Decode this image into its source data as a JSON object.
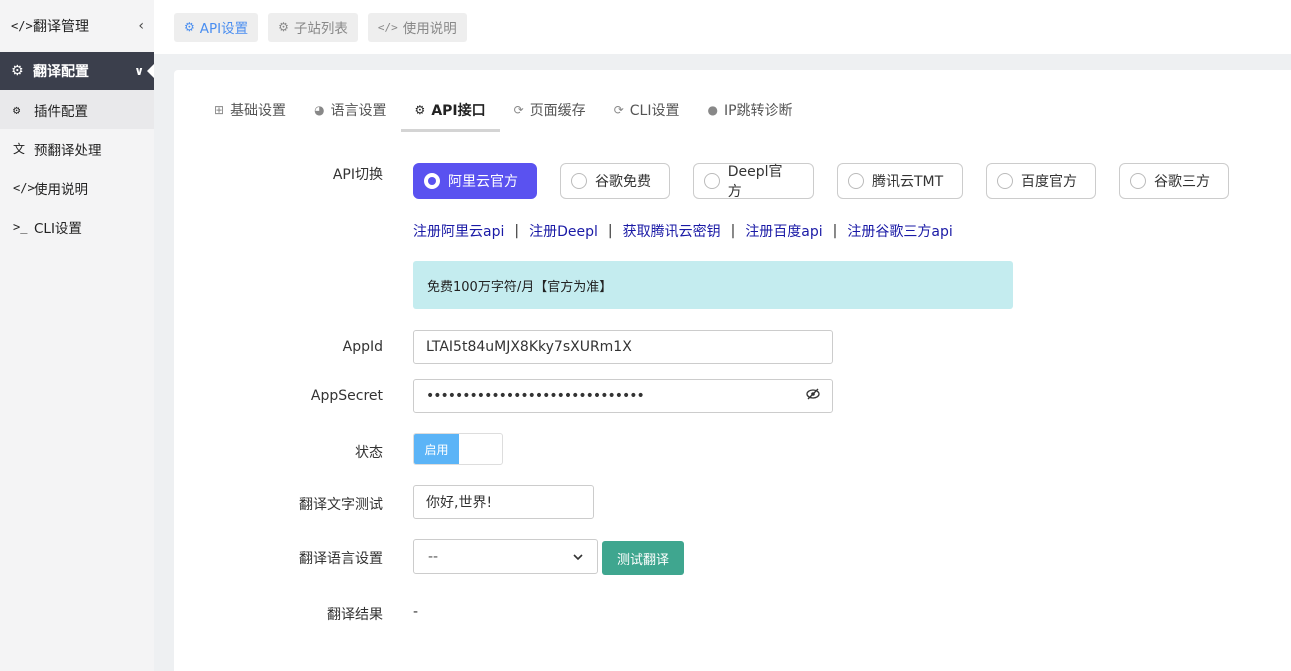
{
  "sidebar": {
    "header": {
      "icon": "code-icon",
      "label": "翻译管理",
      "collapse": "‹"
    },
    "section": {
      "icon": "gear-icon",
      "label": "翻译配置",
      "chevron": "⌄"
    },
    "items": [
      {
        "icon": "gear-icon",
        "label": "插件配置"
      },
      {
        "icon": "translate-icon",
        "label": "预翻译处理"
      },
      {
        "icon": "code-icon",
        "label": "使用说明"
      },
      {
        "icon": "terminal-icon",
        "label": "CLI设置"
      }
    ]
  },
  "topnav": {
    "buttons": [
      {
        "icon": "gear-icon",
        "label": "API设置"
      },
      {
        "icon": "gears-icon",
        "label": "子站列表"
      },
      {
        "icon": "code-icon",
        "label": "使用说明"
      }
    ]
  },
  "tabs": [
    {
      "icon": "sitemap-icon",
      "label": "基础设置"
    },
    {
      "icon": "dashboard-icon",
      "label": "语言设置"
    },
    {
      "icon": "gear-icon",
      "label": "API接口"
    },
    {
      "icon": "refresh-icon",
      "label": "页面缓存"
    },
    {
      "icon": "refresh-icon",
      "label": "CLI设置"
    },
    {
      "icon": "globe-icon",
      "label": "IP跳转诊断"
    }
  ],
  "form": {
    "api_switch_label": "API切换",
    "providers": [
      "阿里云官方",
      "谷歌免费",
      "Deepl官方",
      "腾讯云TMT",
      "百度官方",
      "谷歌三方"
    ],
    "selected_provider": "阿里云官方",
    "links": [
      "注册阿里云api",
      "注册Deepl",
      "获取腾讯云密钥",
      "注册百度api",
      "注册谷歌三方api"
    ],
    "link_separator": "|",
    "notice": "免费100万字符/月【官方为准】",
    "appid_label": "AppId",
    "appid_value": "LTAI5t84uMJX8Kky7sXURm1X",
    "appsecret_label": "AppSecret",
    "appsecret_value": "••••••••••••••••••••••••••••••",
    "status_label": "状态",
    "status_value": "启用",
    "test_text_label": "翻译文字测试",
    "test_text_value": "你好,世界!",
    "test_lang_label": "翻译语言设置",
    "test_lang_value": "--",
    "test_button": "测试翻译",
    "result_label": "翻译结果",
    "result_value": "-"
  }
}
